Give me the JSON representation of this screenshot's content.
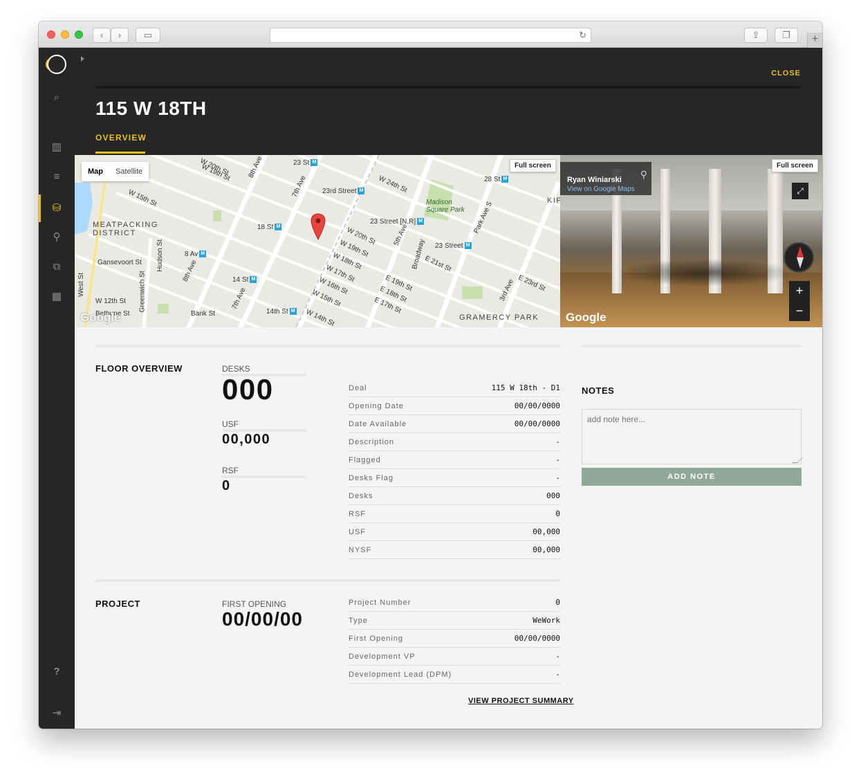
{
  "browser": {
    "back_icon": "chevron-left-icon",
    "forward_icon": "chevron-right-icon",
    "sidebar_icon": "sidebar-toggle-icon",
    "reload_icon": "reload-icon",
    "share_icon": "share-icon",
    "tabs_icon": "tabs-icon",
    "new_tab_label": "+"
  },
  "sidebar": {
    "items": [
      {
        "name": "search-icon",
        "glyph": "⌕"
      },
      {
        "name": "bar-chart-icon",
        "glyph": "▥"
      },
      {
        "name": "list-icon",
        "glyph": "≡"
      },
      {
        "name": "database-icon",
        "glyph": "⛁"
      },
      {
        "name": "location-pin-icon",
        "glyph": "⚲"
      },
      {
        "name": "copy-icon",
        "glyph": "⧉"
      },
      {
        "name": "table-icon",
        "glyph": "▦"
      }
    ],
    "help_glyph": "?",
    "logout_glyph": "⇥"
  },
  "header": {
    "close_label": "CLOSE",
    "title": "115 W 18TH",
    "tab_overview": "OVERVIEW"
  },
  "map": {
    "map_label": "Map",
    "satellite_label": "Satellite",
    "fullscreen_label": "Full screen",
    "google_label": "Google",
    "streets": {
      "w20": "W 20th St",
      "w19": "W 19th St",
      "w18": "W 18th St",
      "w17": "W 17th St",
      "w16": "W 16th St",
      "w15": "W 15th St",
      "w14": "W 14th St",
      "w12": "W 12th St",
      "w24": "W 24th St",
      "e19": "E 19th St",
      "e18": "E 18th St",
      "e17": "E 17th St",
      "e21": "E 21st St",
      "e23": "E 23rd St",
      "ave7": "7th Ave",
      "ave8": "8th Ave",
      "ave5": "5th Ave",
      "broadway": "Broadway",
      "park": "Park Ave S",
      "ave3": "3rd Ave",
      "hudson": "Hudson St",
      "greenwich": "Greenwich St",
      "west": "West St",
      "gansevoort": "Gansevoort St",
      "bank": "Bank St",
      "bethune": "Bethune St"
    },
    "stations": {
      "s23": "23 St",
      "s23rd": "23rd Street",
      "s28": "28 St",
      "s23nr": "23 Street [N,R]",
      "s18": "18 St",
      "s23b": "23 Street",
      "s8av": "8 Av",
      "s14": "14 St",
      "s14th": "14th St"
    },
    "areas": {
      "meatpacking": "MEATPACKING DISTRICT",
      "gramercy": "GRAMERCY PARK",
      "madison": "Madison Square Park",
      "kip": "KIP"
    }
  },
  "street_view": {
    "author": "Ryan Winiarski",
    "link": "View on Google Maps",
    "fullscreen_label": "Full screen",
    "google_label": "Google",
    "zoom_in": "+",
    "zoom_out": "−"
  },
  "floor_overview": {
    "title": "FLOOR OVERVIEW",
    "desks_label": "DESKS",
    "desks_value": "000",
    "usf_label": "USF",
    "usf_value": "00,000",
    "rsf_label": "RSF",
    "rsf_value": "0",
    "rows": [
      {
        "k": "Deal",
        "v": "115 W 18th - D1"
      },
      {
        "k": "Opening Date",
        "v": "00/00/0000"
      },
      {
        "k": "Date Available",
        "v": "00/00/0000"
      },
      {
        "k": "Description",
        "v": "-"
      },
      {
        "k": "Flagged",
        "v": "-"
      },
      {
        "k": "Desks Flag",
        "v": "-"
      },
      {
        "k": "Desks",
        "v": "000"
      },
      {
        "k": "RSF",
        "v": "0"
      },
      {
        "k": "USF",
        "v": "00,000"
      },
      {
        "k": "NYSF",
        "v": "00,000"
      }
    ]
  },
  "notes": {
    "title": "NOTES",
    "placeholder": "add note here...",
    "add_label": "ADD NOTE"
  },
  "project": {
    "title": "PROJECT",
    "first_opening_label": "FIRST OPENING",
    "first_opening_value": "00/00/00",
    "rows": [
      {
        "k": "Project Number",
        "v": "0"
      },
      {
        "k": "Type",
        "v": "WeWork"
      },
      {
        "k": "First Opening",
        "v": "00/00/0000"
      },
      {
        "k": "Development VP",
        "v": "-"
      },
      {
        "k": "Development Lead (DPM)",
        "v": "-"
      }
    ],
    "summary_link": "VIEW PROJECT SUMMARY"
  }
}
